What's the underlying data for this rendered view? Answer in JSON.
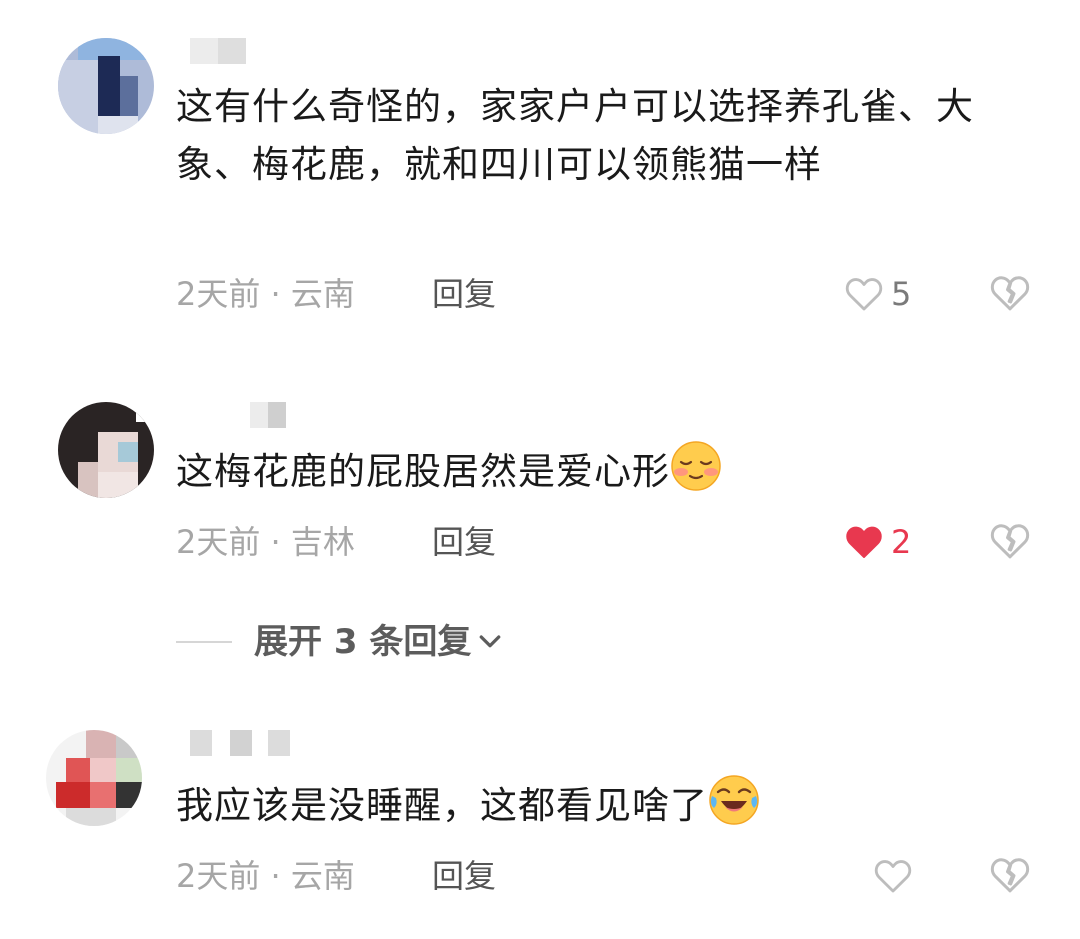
{
  "comments": [
    {
      "text": "这有什么奇怪的，家家户户可以选择养孔雀、大象、梅花鹿，就和四川可以领熊猫一样",
      "time_location": "2天前 · 云南",
      "reply_label": "回复",
      "likes": "5",
      "liked": false
    },
    {
      "text": "这梅花鹿的屁股居然是爱心形",
      "emoji": "shy-smile-emoji",
      "time_location": "2天前 · 吉林",
      "reply_label": "回复",
      "likes": "2",
      "liked": true
    },
    {
      "text": "我应该是没睡醒，这都看见啥了",
      "emoji": "laugh-cry-emoji",
      "time_location": "2天前 · 云南",
      "reply_label": "回复",
      "likes": "",
      "liked": false
    }
  ],
  "expand_replies": {
    "label": "展开 3 条回复"
  },
  "colors": {
    "text": "#1a1a1a",
    "meta": "#a6a6a6",
    "liked_heart": "#e8384f",
    "icon_gray": "#bdbdbd"
  },
  "icons": {
    "like": "heart-outline-icon",
    "liked": "heart-filled-icon",
    "dislike": "broken-heart-icon",
    "expand": "chevron-down-icon"
  }
}
